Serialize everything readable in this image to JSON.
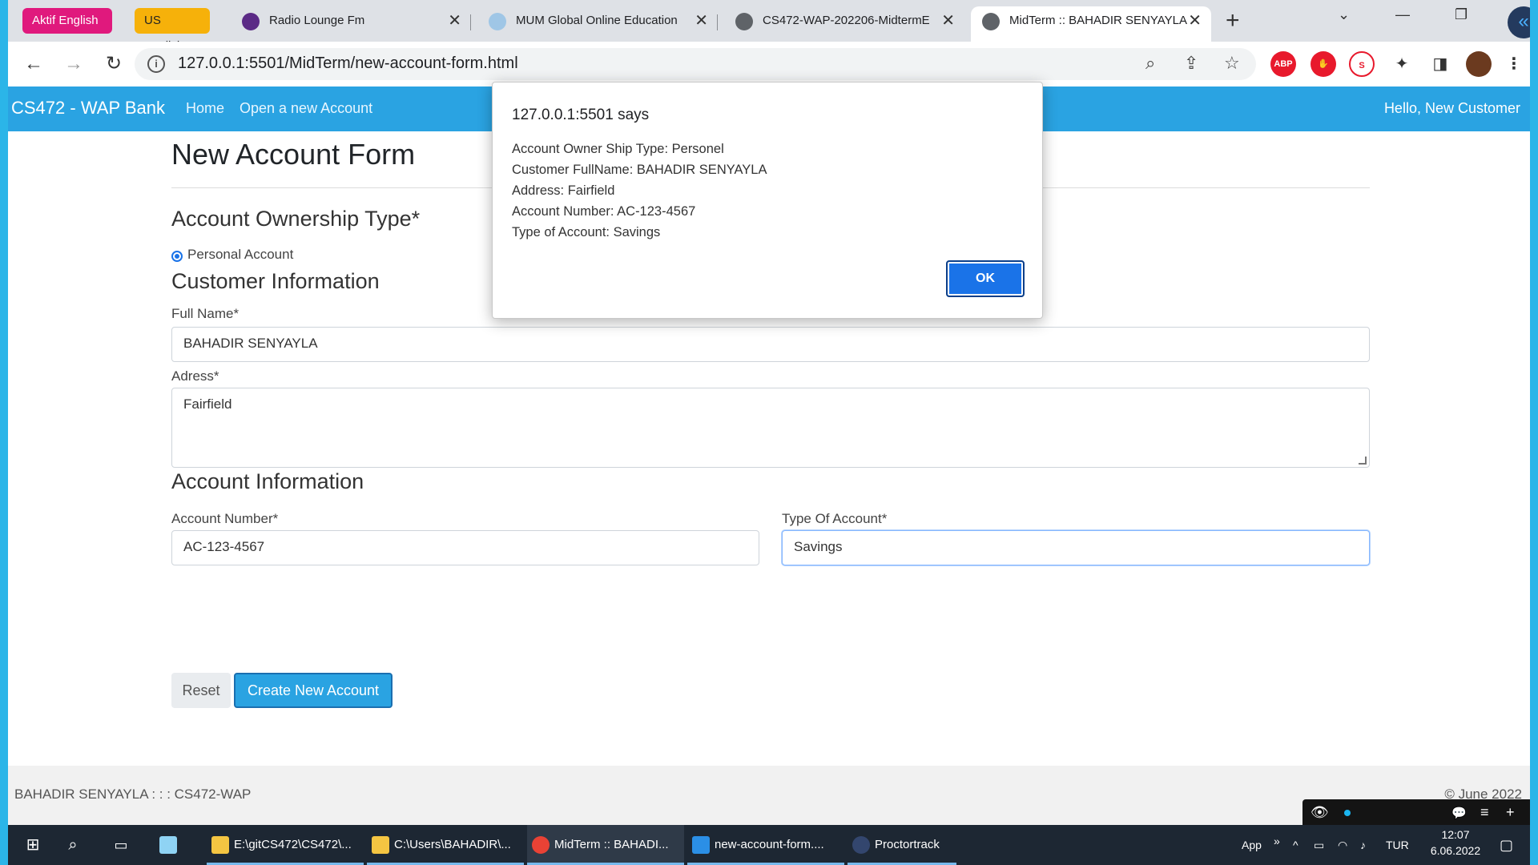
{
  "browser": {
    "bookmarks": [
      "Aktif English",
      "US English"
    ],
    "tabs": [
      {
        "title": "Radio Lounge Fm",
        "close": "✕"
      },
      {
        "title": "MUM Global Online Education",
        "close": "✕"
      },
      {
        "title": "CS472-WAP-202206-MidtermE",
        "close": "✕"
      },
      {
        "title": "MidTerm :: BAHADIR SENYAYLA",
        "close": "✕"
      }
    ],
    "new_tab": "+",
    "url": "127.0.0.1:5501/MidTerm/new-account-form.html",
    "ext_abp": "ABP"
  },
  "navbar": {
    "brand": "CS472 - WAP Bank",
    "links": [
      "Home",
      "Open a new Account"
    ],
    "greeting": "Hello, New Customer"
  },
  "form": {
    "title": "New Account Form",
    "ownership_heading": "Account Ownership Type*",
    "ownership_option": "Personal Account",
    "customer_heading": "Customer Information",
    "fullname_label": "Full Name*",
    "fullname_value": "BAHADIR SENYAYLA",
    "address_label": "Adress*",
    "address_value": "Fairfield",
    "account_heading": "Account Information",
    "account_number_label": "Account Number*",
    "account_number_value": "AC-123-4567",
    "type_label": "Type Of Account*",
    "type_value": "Savings",
    "reset_label": "Reset",
    "create_label": "Create New Account"
  },
  "footer": {
    "left": "BAHADIR SENYAYLA : : : CS472-WAP",
    "right": "© June 2022"
  },
  "dialog": {
    "title": "127.0.0.1:5501 says",
    "lines": [
      "Account Owner Ship Type: Personel",
      "Customer FullName: BAHADIR SENYAYLA",
      "Address: Fairfield",
      "Account Number: AC-123-4567",
      "Type of Account: Savings"
    ],
    "ok_label": "OK"
  },
  "taskbar": {
    "items": [
      "E:\\gitCS472\\CS472\\...",
      "C:\\Users\\BAHADIR\\...",
      "MidTerm :: BAHADI...",
      "new-account-form....",
      "Proctortrack"
    ],
    "app_label": "App",
    "language": "TUR",
    "time": "12:07",
    "date": "6.06.2022"
  },
  "colors": {
    "navbar": "#2aa3e2",
    "accent": "#1a73e8",
    "aktif_pill": "#e0197d",
    "us_pill": "#f6b10a"
  }
}
